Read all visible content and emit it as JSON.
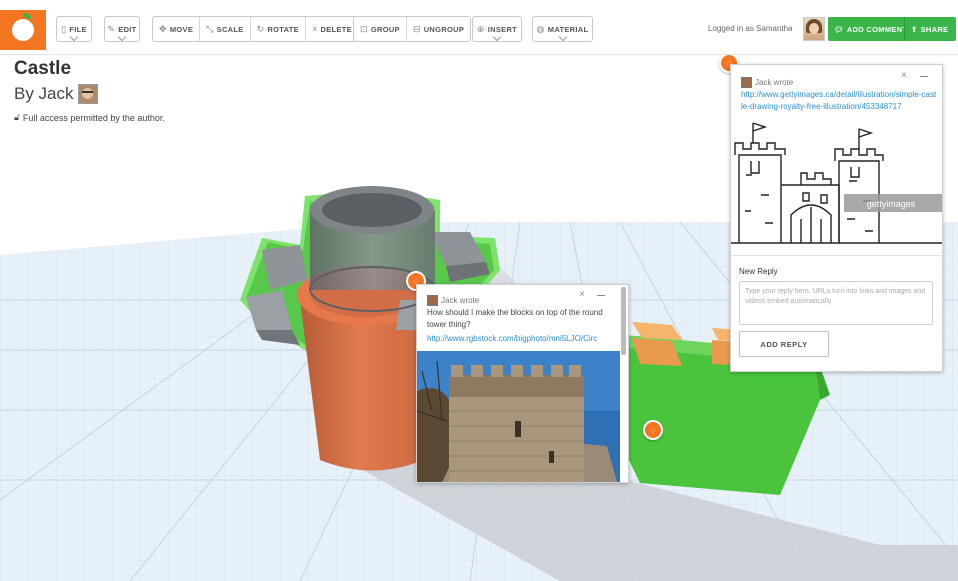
{
  "toolbar": {
    "file": "FILE",
    "edit": "EDIT",
    "move": "MOVE",
    "scale": "SCALE",
    "rotate": "ROTATE",
    "delete": "DELETE",
    "group": "GROUP",
    "ungroup": "UNGROUP",
    "insert": "INSERT",
    "material": "MATERIAL",
    "logged_in": "Logged in as Samantha",
    "add_comment": "ADD COMMENT",
    "share": "SHARE"
  },
  "model": {
    "title": "Castle",
    "byline": "By Jack",
    "access": "Full access permitted by the author."
  },
  "comment1": {
    "author": "Jack wrote",
    "text": "How should I make the blocks on top of the round tower thing?",
    "link": "http://www.rgbstock.com/bigphoto/mni5LJO/Circ"
  },
  "comment2": {
    "author": "Jack wrote",
    "link": "http://www.gettyimages.ca/detail/illustration/simple-castle-drawing-royalty-free-illustration/453348717",
    "watermark": "gettyimages",
    "new_reply_label": "New Reply",
    "reply_placeholder": "Type your reply here. URLs turn into links and images and videos embed automatically.",
    "add_reply": "ADD REPLY"
  },
  "colors": {
    "brand_orange": "#f47521",
    "accent_green": "#39b54a",
    "link_blue": "#2a8fd0"
  }
}
